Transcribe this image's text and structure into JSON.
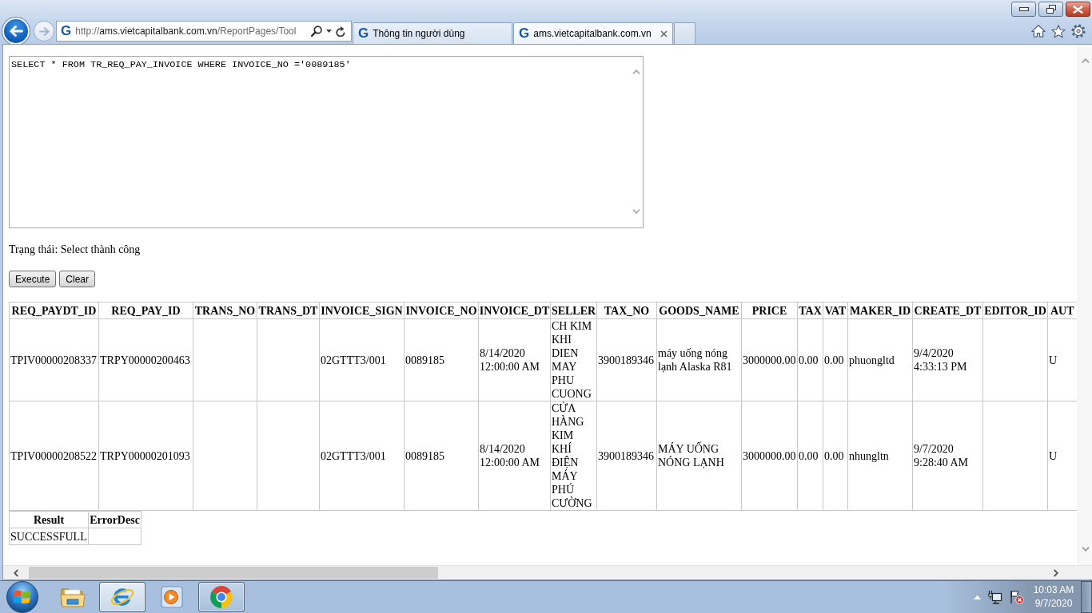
{
  "browser": {
    "navigation": [
      {
        "kind": "back",
        "disabled": false
      },
      {
        "kind": "forward",
        "disabled": true
      }
    ],
    "address_bar": {
      "logo": "G",
      "scheme": "http://",
      "domain": "ams.vietcapitalbank.com.vn",
      "path": "/ReportPages/Tool"
    },
    "tabs": [
      {
        "logo": "G",
        "label": "Thông tin người dùng",
        "selected": false
      },
      {
        "logo": "G",
        "label": "ams.vietcapitalbank.com.vn",
        "selected": true
      }
    ]
  },
  "query_editor": {
    "value": "SELECT * FROM TR_REQ_PAY_INVOICE WHERE INVOICE_NO ='0089185'"
  },
  "status_text": "Trạng thái: Select thành công",
  "buttons": [
    "Execute",
    "Clear"
  ],
  "results_table": {
    "columns": [
      "REQ_PAYDT_ID",
      "REQ_PAY_ID",
      "TRANS_NO",
      "TRANS_DT",
      "INVOICE_SIGN",
      "INVOICE_NO",
      "INVOICE_DT",
      "SELLER",
      "TAX_NO",
      "GOODS_NAME",
      "PRICE",
      "TAX",
      "VAT",
      "MAKER_ID",
      "CREATE_DT",
      "EDITOR_ID",
      "AUT"
    ],
    "rows": [
      [
        "TPIV00000208337",
        "TRPY00000200463",
        null,
        null,
        "02GTTT3/001",
        "0089185",
        "8/14/2020 12:00:00 AM",
        "CH KIM KHI DIEN MAY PHU CUONG",
        "3900189346",
        "máy uống nóng lạnh Alaska R81",
        "3000000.00",
        "0.00",
        "0.00",
        "phuongltd",
        "9/4/2020 4:33:13 PM",
        null,
        "U"
      ],
      [
        "TPIV00000208522",
        "TRPY00000201093",
        null,
        null,
        "02GTTT3/001",
        "0089185",
        "8/14/2020 12:00:00 AM",
        "CỬA HÀNG KIM KHÍ ĐIỆN MÁY PHÚ CƯỜNG",
        "3900189346",
        "MÁY UỐNG NÓNG LẠNH",
        "3000000.00",
        "0.00",
        "0.00",
        "nhungltn",
        "9/7/2020 9:28:40 AM",
        null,
        "U"
      ]
    ]
  },
  "summary_table": {
    "columns": [
      "Result",
      "ErrorDesc"
    ],
    "rows": [
      [
        "SUCCESSFULL",
        null
      ]
    ]
  },
  "taskbar": {
    "apps": [
      {
        "kind": "folder",
        "running": false,
        "selected": false
      },
      {
        "kind": "ie",
        "running": true,
        "selected": true
      },
      {
        "kind": "player",
        "running": false,
        "selected": false
      },
      {
        "kind": "chrome",
        "running": true,
        "selected": false
      }
    ],
    "clock": {
      "time": "10:03 AM",
      "date": "9/7/2020"
    }
  }
}
